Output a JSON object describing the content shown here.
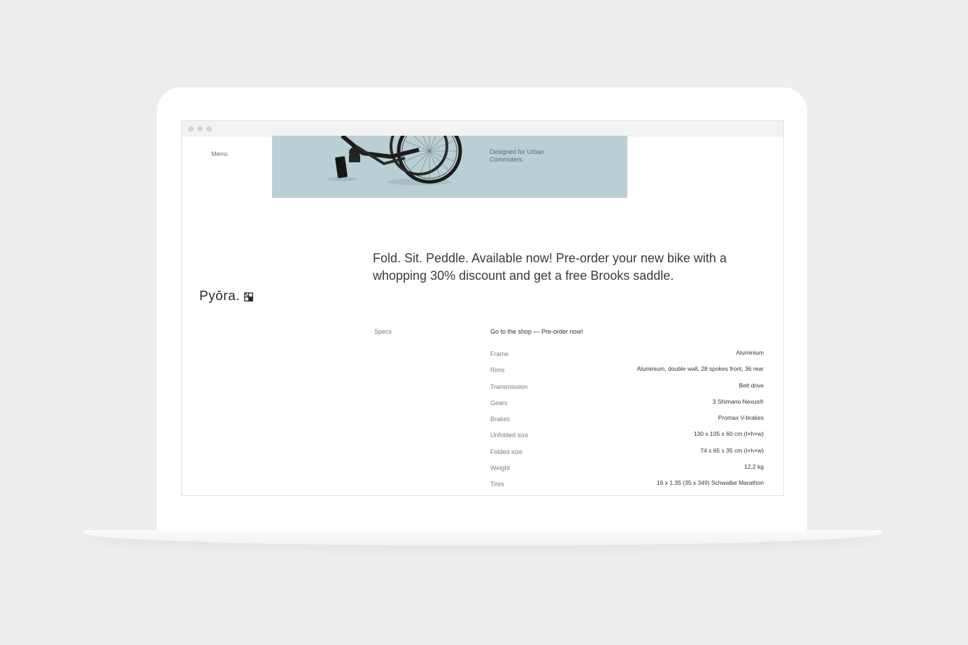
{
  "browser": {
    "window_dots": [
      "close",
      "minimize",
      "maximize"
    ]
  },
  "nav": {
    "menu_label": "Menu"
  },
  "hero": {
    "caption": "Designed for Urban Commuters.",
    "background_color": "#bacfd5"
  },
  "headline": "Fold. Sit. Peddle. Available now! Pre-order your new bike with a whopping 30% discount and get a free Brooks saddle.",
  "brand": {
    "name": "Pyōra.",
    "mark_icon": "square-grid-logo-icon"
  },
  "specs": {
    "section_label": "Specs",
    "shop_link": "Go to the shop — Pre-order now!",
    "rows": [
      {
        "key": "Frame",
        "value": "Aluminium"
      },
      {
        "key": "Rims",
        "value": "Aluminium, double wall, 28 spokes front, 36 rear"
      },
      {
        "key": "Transmission",
        "value": "Belt drive"
      },
      {
        "key": "Gears",
        "value": "3 Shimano Nexus®"
      },
      {
        "key": "Brakes",
        "value": "Promax V-brakes"
      },
      {
        "key": "Unfolded size",
        "value": "130 x 105 x 60 cm (l×h×w)"
      },
      {
        "key": "Folded size",
        "value": "74 x 65 x 35 cm (l×h×w)"
      },
      {
        "key": "Weight",
        "value": "12,2 kg"
      },
      {
        "key": "Tires",
        "value": "16 x 1.35 (35 x 349) Schwalbe Marathon"
      }
    ]
  }
}
